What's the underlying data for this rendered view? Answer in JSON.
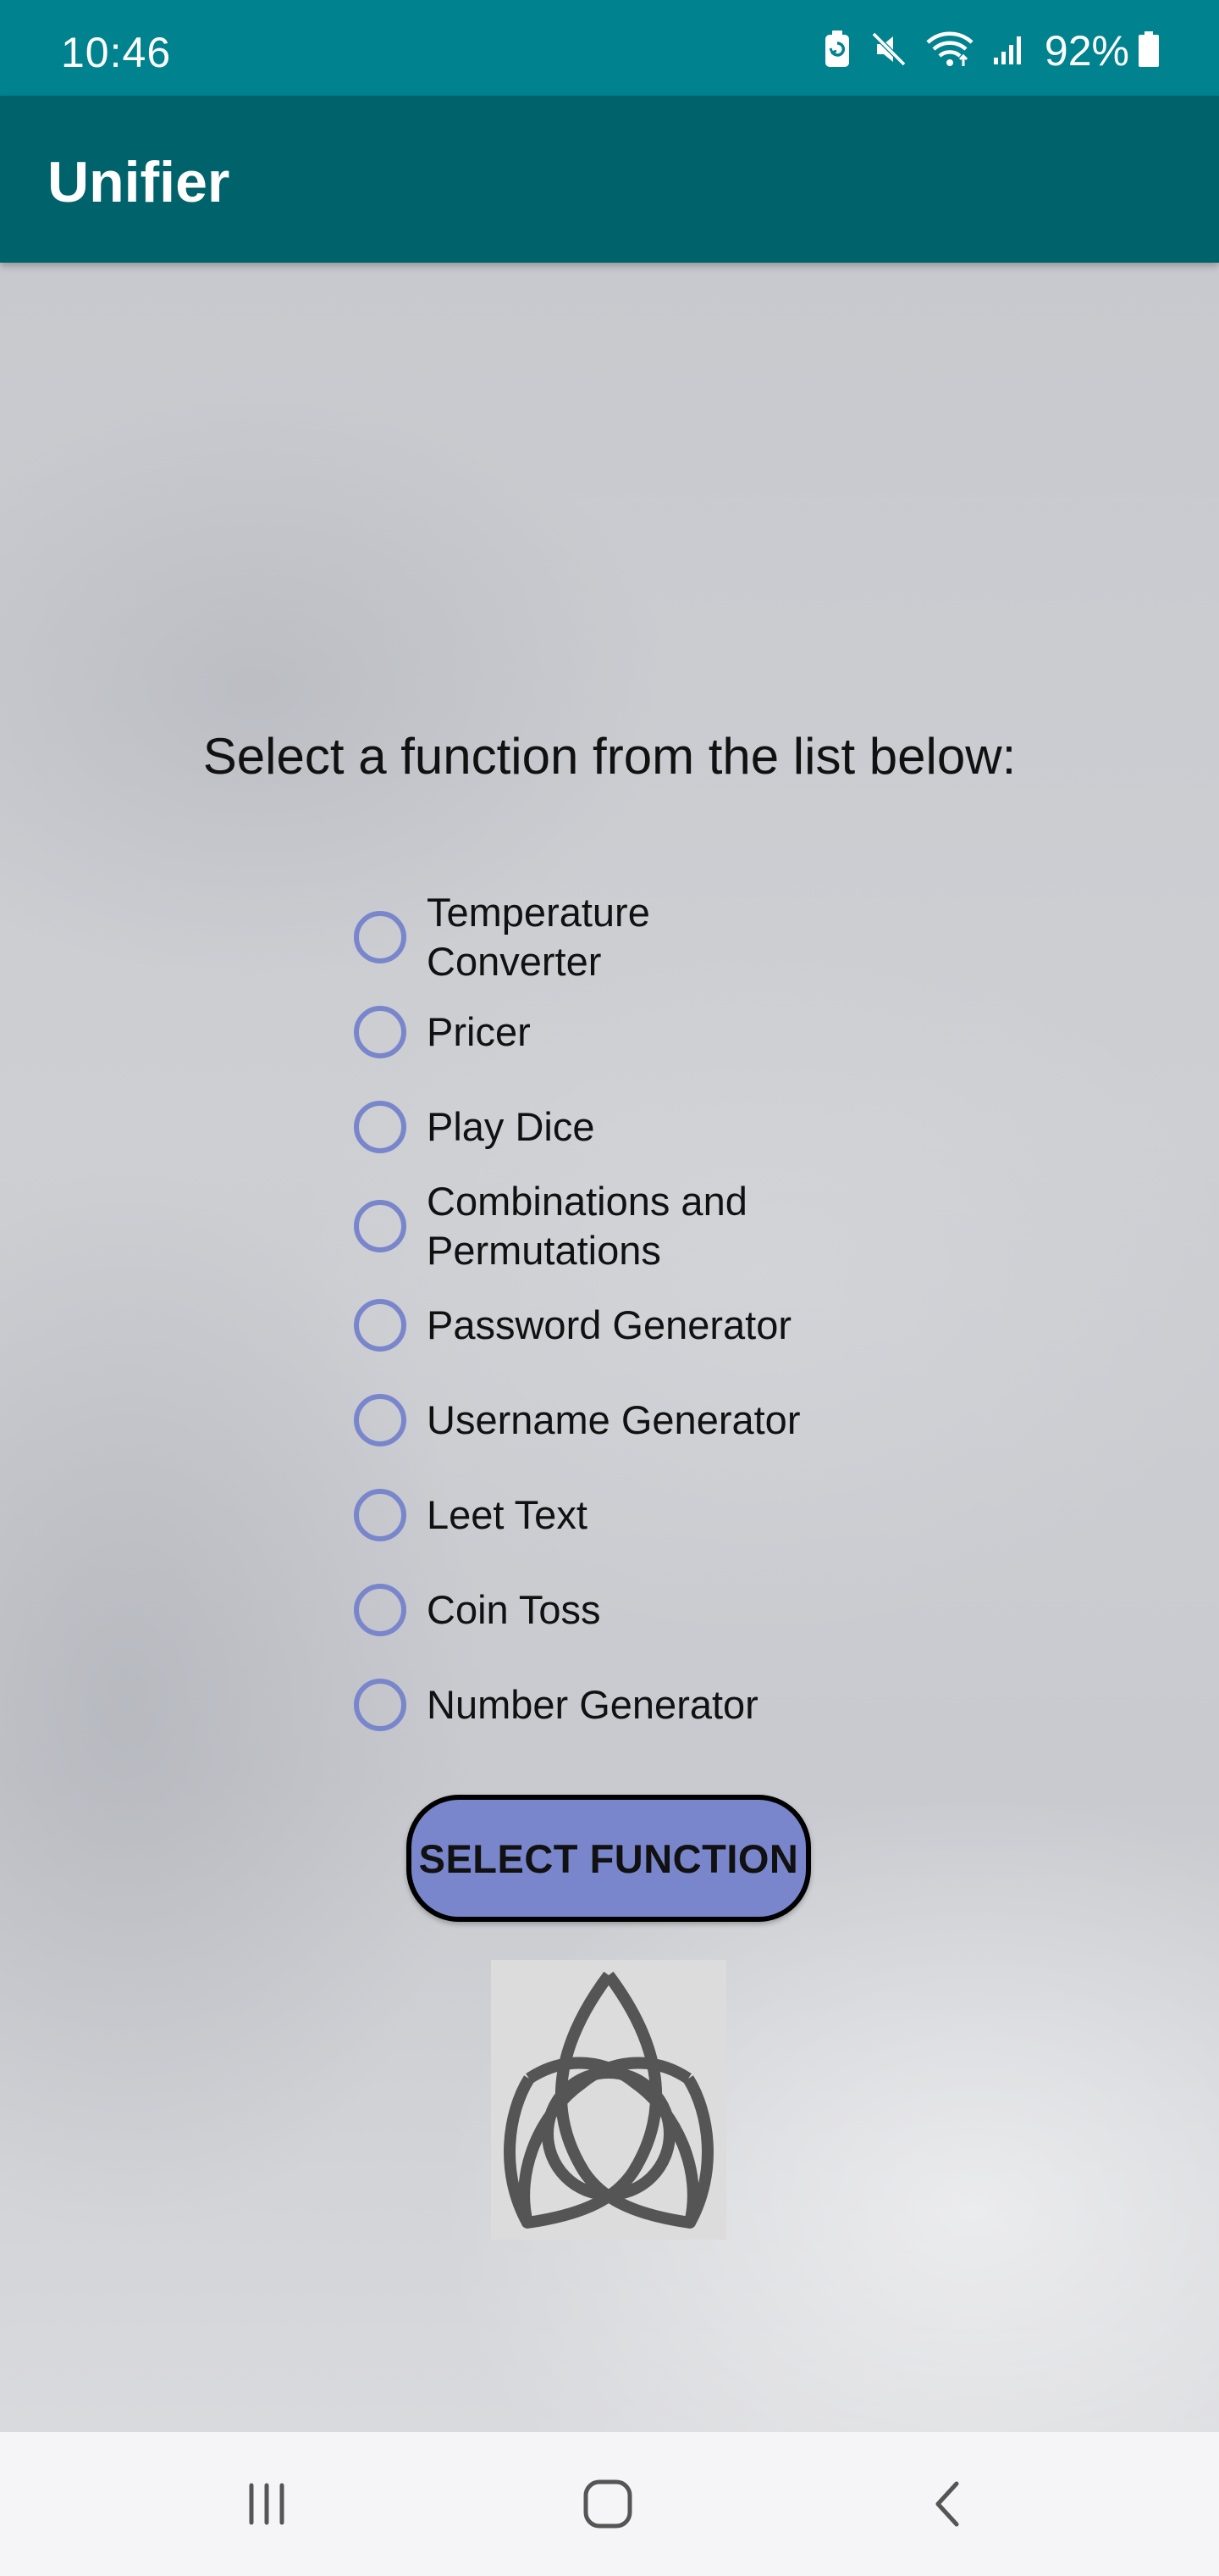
{
  "status_bar": {
    "time": "10:46",
    "battery_percent": "92%",
    "icons": [
      "battery-saver-icon",
      "mute-icon",
      "wifi-icon",
      "signal-icon",
      "battery-icon"
    ]
  },
  "app_bar": {
    "title": "Unifier"
  },
  "main": {
    "prompt": "Select a function from the list below:",
    "options": [
      {
        "label": "Temperature Converter",
        "selected": false
      },
      {
        "label": "Pricer",
        "selected": false
      },
      {
        "label": "Play Dice",
        "selected": false
      },
      {
        "label": "Combinations and Permutations",
        "selected": false
      },
      {
        "label": "Password Generator",
        "selected": false
      },
      {
        "label": "Username Generator",
        "selected": false
      },
      {
        "label": "Leet Text",
        "selected": false
      },
      {
        "label": "Coin Toss",
        "selected": false
      },
      {
        "label": "Number Generator",
        "selected": false
      }
    ],
    "button_label": "SELECT FUNCTION",
    "logo_icon": "triquetra-icon"
  },
  "nav_bar": {
    "icons": [
      "recent-apps-icon",
      "home-icon",
      "back-icon"
    ]
  },
  "colors": {
    "status_bar": "#00838f",
    "app_bar": "#00636b",
    "accent": "#7986cb",
    "background": "#c9cbd0"
  }
}
